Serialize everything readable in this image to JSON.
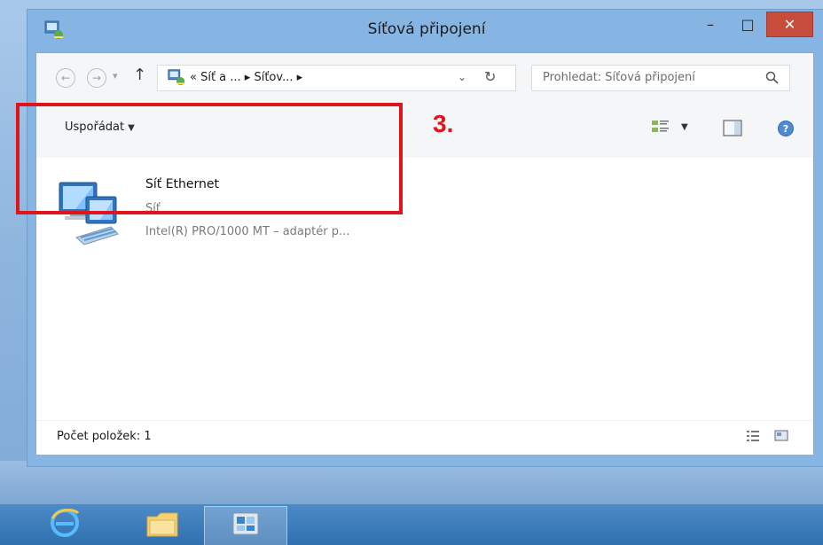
{
  "window": {
    "title": "Síťová připojení",
    "buttons": {
      "minimize": "–",
      "maximize": "□",
      "close": "✕"
    }
  },
  "navigation": {
    "back_icon": "←",
    "forward_icon": "→",
    "recent_icon": "▾",
    "up_icon": "↑",
    "address": "« Síť a ...  ▸  Síťov...  ▸",
    "address_dropdown": "⌄",
    "refresh_icon": "↻",
    "search_placeholder": "Prohledat: Síťová připojení"
  },
  "commandbar": {
    "organize_label": "Uspořádat",
    "organize_arrow": "▼",
    "view_dropdown": "▼"
  },
  "connection": {
    "name": "Síť Ethernet",
    "status": "Síť",
    "adapter": "Intel(R) PRO/1000 MT – adaptér p..."
  },
  "annotation": {
    "step": "3."
  },
  "statusbar": {
    "item_count": "Počet položek: 1"
  },
  "taskbar": {
    "items": [
      "internet-explorer",
      "file-explorer",
      "network-connections"
    ]
  },
  "colors": {
    "highlight": "#e0151b",
    "titlebar": "#86b4e3",
    "close_button": "#c74c3c",
    "taskbar": "#2f6fae"
  }
}
